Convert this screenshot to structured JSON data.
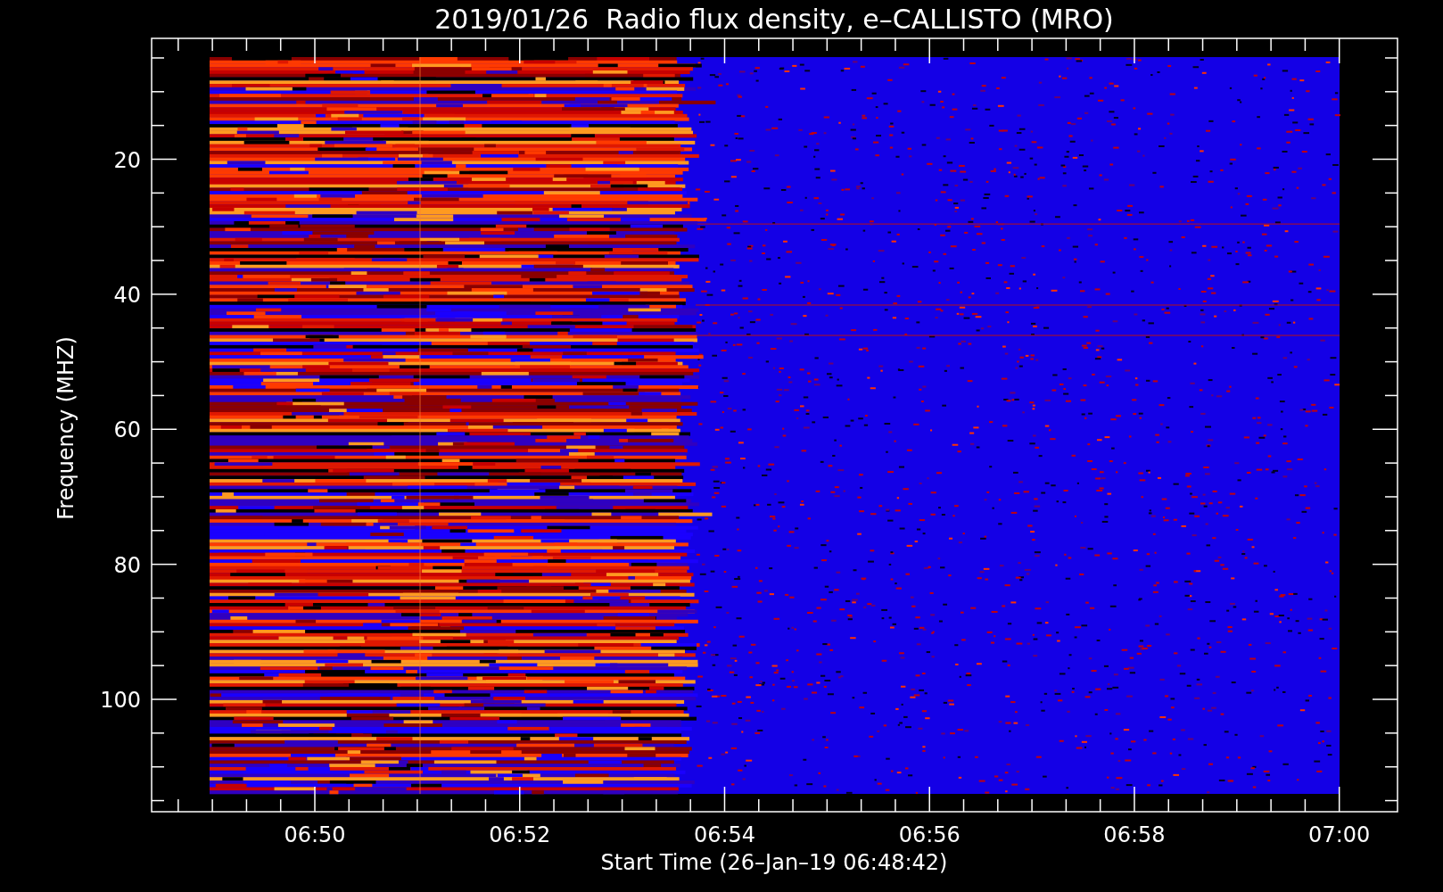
{
  "title": "2019/01/26  Radio flux density, e–CALLISTO (MRO)",
  "y_axis": {
    "label": "Frequency (MHZ)",
    "ticks": [
      "20",
      "40",
      "60",
      "80",
      "100"
    ]
  },
  "x_axis": {
    "label": "Start Time (26–Jan–19 06:48:42)",
    "ticks": [
      "06:50",
      "06:52",
      "06:54",
      "06:56",
      "06:58",
      "07:00"
    ]
  }
}
